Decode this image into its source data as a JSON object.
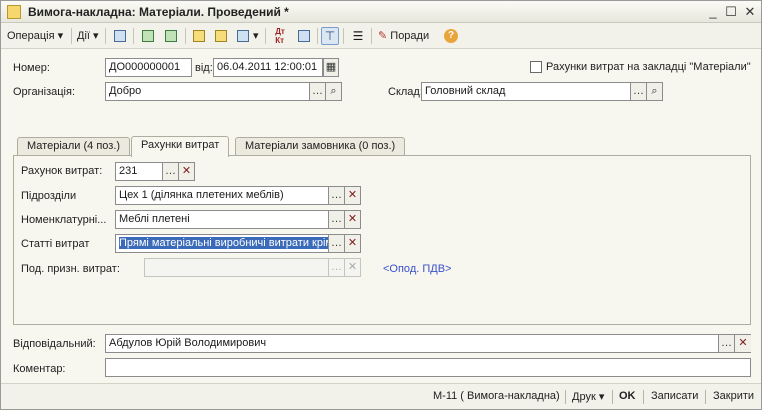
{
  "window": {
    "title": "Вимога-накладна: Матеріали. Проведений *",
    "minimize": "_",
    "maximize": "☐",
    "close": "✕"
  },
  "toolbar": {
    "operation_label": "Операція",
    "actions_label": "Дії",
    "tips_label": "Поради"
  },
  "header": {
    "number_label": "Номер:",
    "number_value": "ДО000000001",
    "date_label": "від:",
    "date_value": "06.04.2011 12:00:01",
    "cost_accounts_checkbox_label": "Рахунки витрат на закладці \"Матеріали\"",
    "org_label": "Організація:",
    "org_value": "Добро",
    "warehouse_label": "Склад:",
    "warehouse_value": "Головний склад"
  },
  "tabs": [
    {
      "label": "Матеріали (4 поз.)",
      "active": false
    },
    {
      "label": "Рахунки витрат",
      "active": true
    },
    {
      "label": "Матеріали замовника (0 поз.)",
      "active": false
    }
  ],
  "cost_tab": {
    "account_label": "Рахунок витрат:",
    "account_value": "231",
    "division_label": "Підрозділи",
    "division_value": "Цех 1 (ділянка плетених меблів)",
    "nomenclature_label": "Номенклатурні...",
    "nomenclature_value": "Меблі плетені",
    "cost_items_label": "Статті витрат",
    "cost_items_value": "Прямі матеріальні виробничі витрати крім",
    "tax_label": "Под. призн. витрат:",
    "tax_value": "",
    "vat_link": "<Опод. ПДВ>"
  },
  "footer": {
    "responsible_label": "Відповідальний:",
    "responsible_value": "Абдулов Юрій Володимирович",
    "comment_label": "Коментар:",
    "comment_value": ""
  },
  "statusbar": {
    "form_label": "М-11 ( Вимога-накладна)",
    "print_label": "Друк",
    "ok_label": "OK",
    "save_label": "Записати",
    "close_label": "Закрити"
  }
}
